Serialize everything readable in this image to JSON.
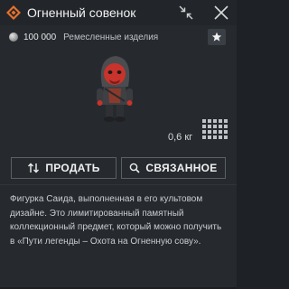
{
  "window": {
    "title": "Огненный совенок",
    "logo_icon": "rune-diamond-icon",
    "collapse_icon": "collapse-arrows-icon",
    "close_icon": "close-icon"
  },
  "item": {
    "price_icon": "silver-coin-icon",
    "price": "100 000",
    "category": "Ремесленные изделия",
    "favorite_icon": "star-icon",
    "weight": "0,6 кг",
    "inventory_icon": "inventory-grid-icon",
    "description": "Фигурка Саида, выполненная в его культовом дизайне. Это лимитированный памятный коллекционный предмет, который можно получить в «Пути легенды – Охота на Огненную сову»."
  },
  "actions": {
    "sell_label": "ПРОДАТЬ",
    "sell_icon": "sell-arrows-icon",
    "related_label": "СВЯЗАННОЕ",
    "related_icon": "search-icon"
  },
  "colors": {
    "accent_orange": "#e8712a",
    "panel_bg": "#262a2f",
    "figurine_skin": "#c8332b",
    "figurine_hood": "#4a4c50"
  }
}
